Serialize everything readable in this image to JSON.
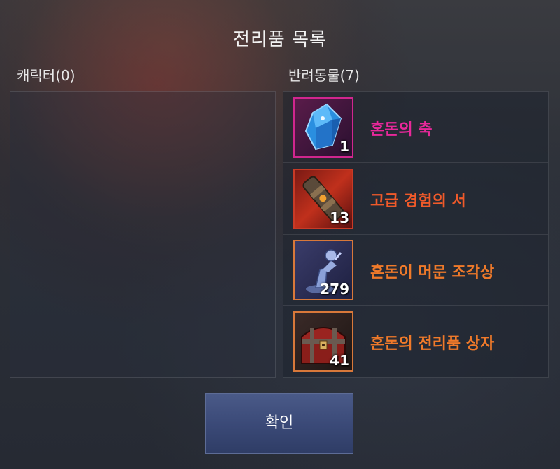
{
  "title": "전리품 목록",
  "character_header": "캐릭터(0)",
  "pet_header": "반려동물(7)",
  "items": [
    {
      "name": "혼돈의 축",
      "count": "1",
      "name_color": "#e8289a",
      "border_color": "#d0268e",
      "icon": "blue-crystal-icon"
    },
    {
      "name": "고급 경험의 서",
      "count": "13",
      "name_color": "#f05a2a",
      "border_color": "#c83a26",
      "icon": "scroll-icon"
    },
    {
      "name": "혼돈이 머문 조각상",
      "count": "279",
      "name_color": "#f07a2a",
      "border_color": "#d8783a",
      "icon": "statue-icon"
    },
    {
      "name": "혼돈의 전리품 상자",
      "count": "41",
      "name_color": "#f07a2a",
      "border_color": "#d8783a",
      "icon": "treasure-chest-icon"
    }
  ],
  "confirm_label": "확인"
}
